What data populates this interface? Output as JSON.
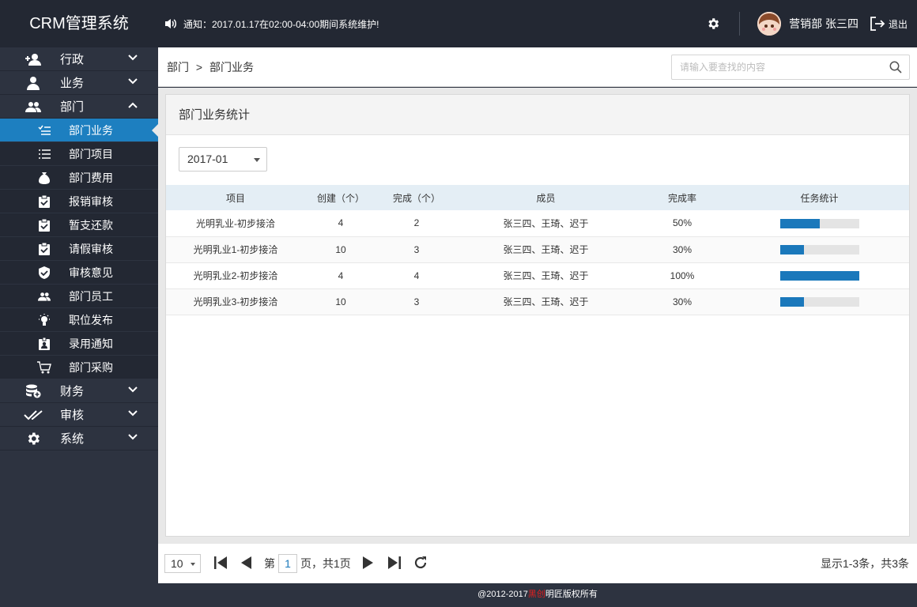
{
  "header": {
    "logo": "CRM管理系统",
    "notice": "通知：2017.01.17在02:00-04:00期间系统维护!",
    "user": "营销部 张三四",
    "logout": "退出"
  },
  "sidebar": {
    "menus": [
      {
        "label": "行政",
        "icon": "add-user-icon"
      },
      {
        "label": "业务",
        "icon": "user-icon"
      },
      {
        "label": "部门",
        "icon": "group-icon"
      }
    ],
    "subitems": [
      {
        "label": "部门业务",
        "icon": "checklist-icon"
      },
      {
        "label": "部门项目",
        "icon": "list-icon"
      },
      {
        "label": "部门费用",
        "icon": "money-bag-icon"
      },
      {
        "label": "报销审核",
        "icon": "clipboard-check-icon"
      },
      {
        "label": "暂支还款",
        "icon": "clipboard-check-icon"
      },
      {
        "label": "请假审核",
        "icon": "clipboard-check-icon"
      },
      {
        "label": "审核意见",
        "icon": "shield-check-icon"
      },
      {
        "label": "部门员工",
        "icon": "group-icon"
      },
      {
        "label": "职位发布",
        "icon": "bulb-icon"
      },
      {
        "label": "录用通知",
        "icon": "badge-icon"
      },
      {
        "label": "部门采购",
        "icon": "cart-icon"
      }
    ],
    "menus2": [
      {
        "label": "财务",
        "icon": "coins-icon"
      },
      {
        "label": "审核",
        "icon": "double-check-icon"
      },
      {
        "label": "系统",
        "icon": "gear-icon"
      }
    ]
  },
  "topbar": {
    "crumb_parent": "部门",
    "crumb_sep": ">",
    "crumb_current": "部门业务",
    "search_placeholder": "请输入要查找的内容"
  },
  "panel": {
    "title": "部门业务统计",
    "month": "2017-01"
  },
  "table": {
    "headers": [
      "项目",
      "创建（个）",
      "完成（个）",
      "成员",
      "完成率",
      "任务统计"
    ],
    "rows": [
      {
        "project": "光明乳业-初步接洽",
        "created": "4",
        "done": "2",
        "members": "张三四、王琦、迟于",
        "rate": "50%",
        "progress": 0.5
      },
      {
        "project": "光明乳业1-初步接洽",
        "created": "10",
        "done": "3",
        "members": "张三四、王琦、迟于",
        "rate": "30%",
        "progress": 0.3
      },
      {
        "project": "光明乳业2-初步接洽",
        "created": "4",
        "done": "4",
        "members": "张三四、王琦、迟于",
        "rate": "100%",
        "progress": 1.0
      },
      {
        "project": "光明乳业3-初步接洽",
        "created": "10",
        "done": "3",
        "members": "张三四、王琦、迟于",
        "rate": "30%",
        "progress": 0.3
      }
    ]
  },
  "pager": {
    "page_size": "10",
    "prefix": "第",
    "page": "1",
    "suffix": "页，共1页",
    "info": "显示1-3条，共3条"
  },
  "footer": {
    "pre": "@2012-2017",
    "brand": "黑创",
    "post": "明匠版权所有"
  },
  "colors": {
    "accent": "#1d7fc0",
    "bar": "#1a78bb",
    "sidebar": "#2d3340",
    "header": "#232833"
  }
}
